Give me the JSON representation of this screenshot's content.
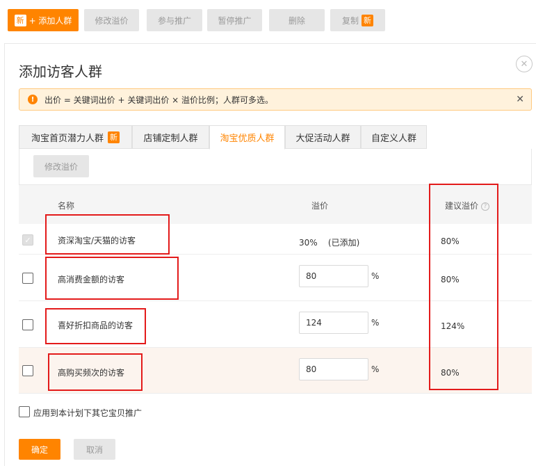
{
  "toolbar": {
    "new_badge": "新",
    "add_label": "+ 添加人群",
    "modify_price": "修改溢价",
    "join_promo": "参与推广",
    "pause_promo": "暂停推广",
    "delete": "删除",
    "copy": "复制"
  },
  "dialog": {
    "title": "添加访客人群",
    "close_glyph": "✕",
    "notice": "出价 = 关键词出价 + 关键词出价 × 溢价比例；人群可多选。",
    "notice_icon": "!",
    "notice_close": "✕",
    "tabs": [
      {
        "label": "淘宝首页潜力人群",
        "badge": "新"
      },
      {
        "label": "店铺定制人群"
      },
      {
        "label": "淘宝优质人群"
      },
      {
        "label": "大促活动人群"
      },
      {
        "label": "自定义人群"
      }
    ],
    "modify_button": "修改溢价",
    "table": {
      "headers": {
        "name": "名称",
        "price": "溢价",
        "suggest": "建议溢价"
      },
      "rows": [
        {
          "name": "资深淘宝/天猫的访客",
          "price_text": "30%    (已添加)",
          "suggest": "80%",
          "checked": true
        },
        {
          "name": "高消费金额的访客",
          "price": "80",
          "unit": "%",
          "suggest": "80%",
          "checked": false
        },
        {
          "name": "喜好折扣商品的访客",
          "price": "124",
          "unit": "%",
          "suggest": "124%",
          "checked": false
        },
        {
          "name": "高购买频次的访客",
          "price": "80",
          "unit": "%",
          "suggest": "80%",
          "checked": false
        }
      ]
    },
    "apply_label": "应用到本计划下其它宝贝推广",
    "ok": "确定",
    "cancel": "取消"
  },
  "colors": {
    "accent": "#ff8400",
    "annotation": "#e31a1a"
  }
}
